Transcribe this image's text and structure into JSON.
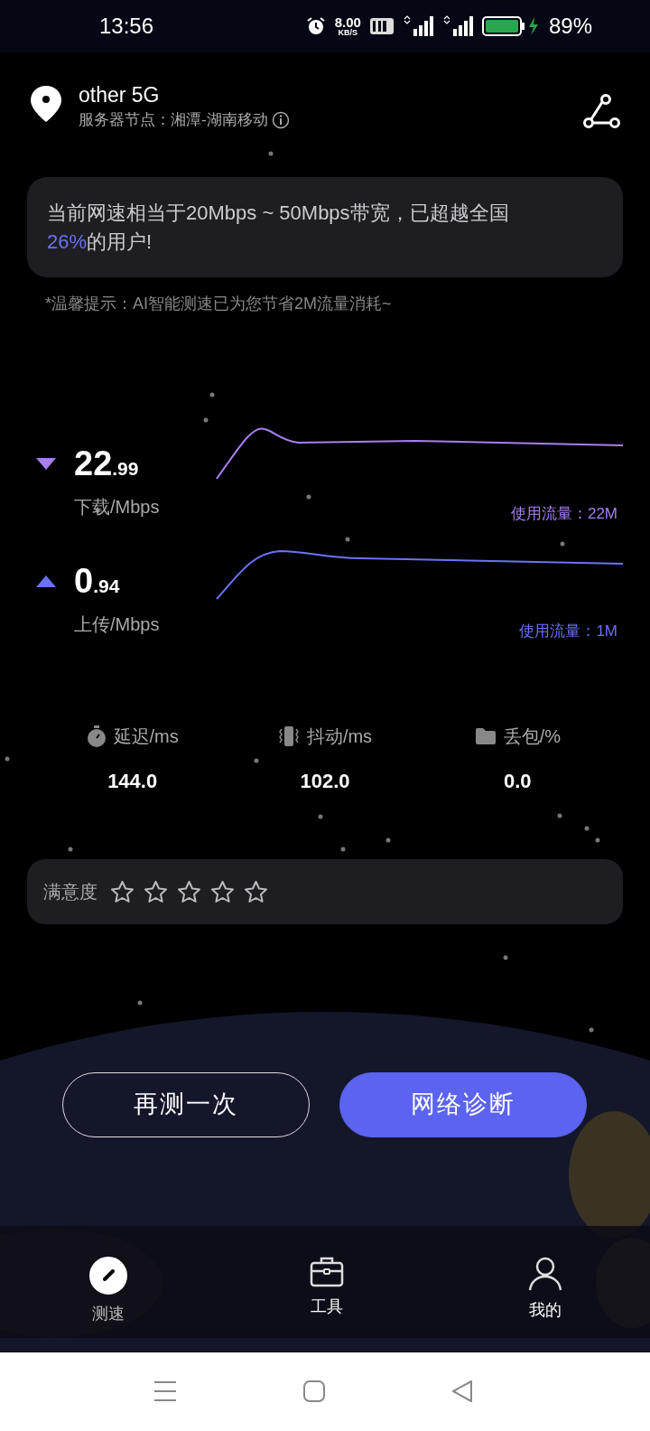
{
  "status_bar": {
    "time": "13:56",
    "net_speed": "8.00",
    "net_speed_unit": "KB/S",
    "battery": "89%"
  },
  "header": {
    "title": "other 5G",
    "server": "服务器节点：湘潭-湖南移动"
  },
  "summary": {
    "text": "当前网速相当于20Mbps ~ 50Mbps带宽，已超越全国",
    "percent": "26%",
    "suffix": "的用户!"
  },
  "tip": "*温馨提示：AI智能测速已为您节省2M流量消耗~",
  "speeds": [
    {
      "kind": "download",
      "whole": "22",
      "fraction": ".99",
      "label": "下载/Mbps",
      "usage": "使用流量：22M",
      "color": "#a77ff0"
    },
    {
      "kind": "upload",
      "whole": "0",
      "fraction": ".94",
      "label": "上传/Mbps",
      "usage": "使用流量：1M",
      "color": "#6a73f5"
    }
  ],
  "stats": [
    {
      "kind": "latency",
      "label": "延迟/ms",
      "value": "144.0"
    },
    {
      "kind": "jitter",
      "label": "抖动/ms",
      "value": "102.0"
    },
    {
      "kind": "loss",
      "label": "丢包/%",
      "value": "0.0"
    }
  ],
  "rating": {
    "label": "满意度",
    "stars": 0
  },
  "buttons": [
    {
      "label": "再测一次",
      "kind": "outline"
    },
    {
      "label": "网络诊断",
      "kind": "primary"
    }
  ],
  "nav": [
    {
      "kind": "speed",
      "label": "测速",
      "selected": true
    },
    {
      "kind": "tools",
      "label": "工具",
      "selected": false
    },
    {
      "kind": "me",
      "label": "我的",
      "selected": false
    }
  ]
}
